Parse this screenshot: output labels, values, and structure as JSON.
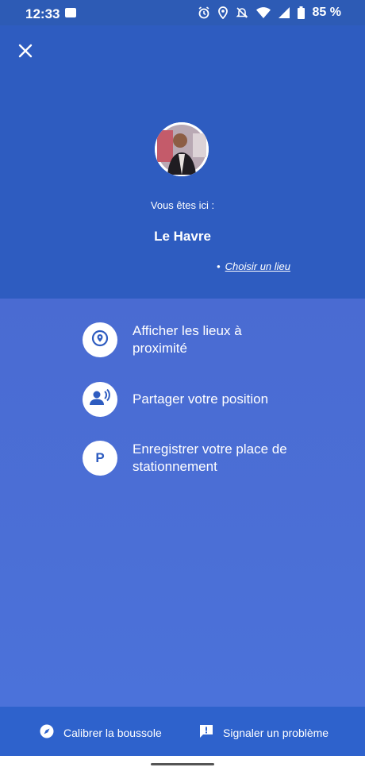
{
  "status_bar": {
    "time": "12:33",
    "battery": "85 %",
    "icons": [
      "image-icon",
      "alarm-icon",
      "location-icon",
      "notifications-off-icon",
      "wifi-icon",
      "signal-icon",
      "battery-icon"
    ]
  },
  "header": {
    "close_icon": "close-icon",
    "you_are_here": "Vous êtes ici :",
    "city": "Le Havre",
    "choose_bullet": "•",
    "choose_place": "Choisir un lieu"
  },
  "actions": [
    {
      "icon": "place-icon",
      "label": "Afficher les lieux à proximité"
    },
    {
      "icon": "share-location-icon",
      "label": "Partager votre position"
    },
    {
      "icon": "parking-icon",
      "label": "Enregistrer votre place de stationnement",
      "glyph": "P"
    }
  ],
  "bottom_bar": {
    "calibrate": "Calibrer la boussole",
    "report": "Signaler un problème"
  },
  "colors": {
    "header_bg": "#2e5cc0",
    "map_bg": "#4a6bd0",
    "bottom_bar_bg": "#2e62cc",
    "icon_blue": "#2e5cc0"
  }
}
